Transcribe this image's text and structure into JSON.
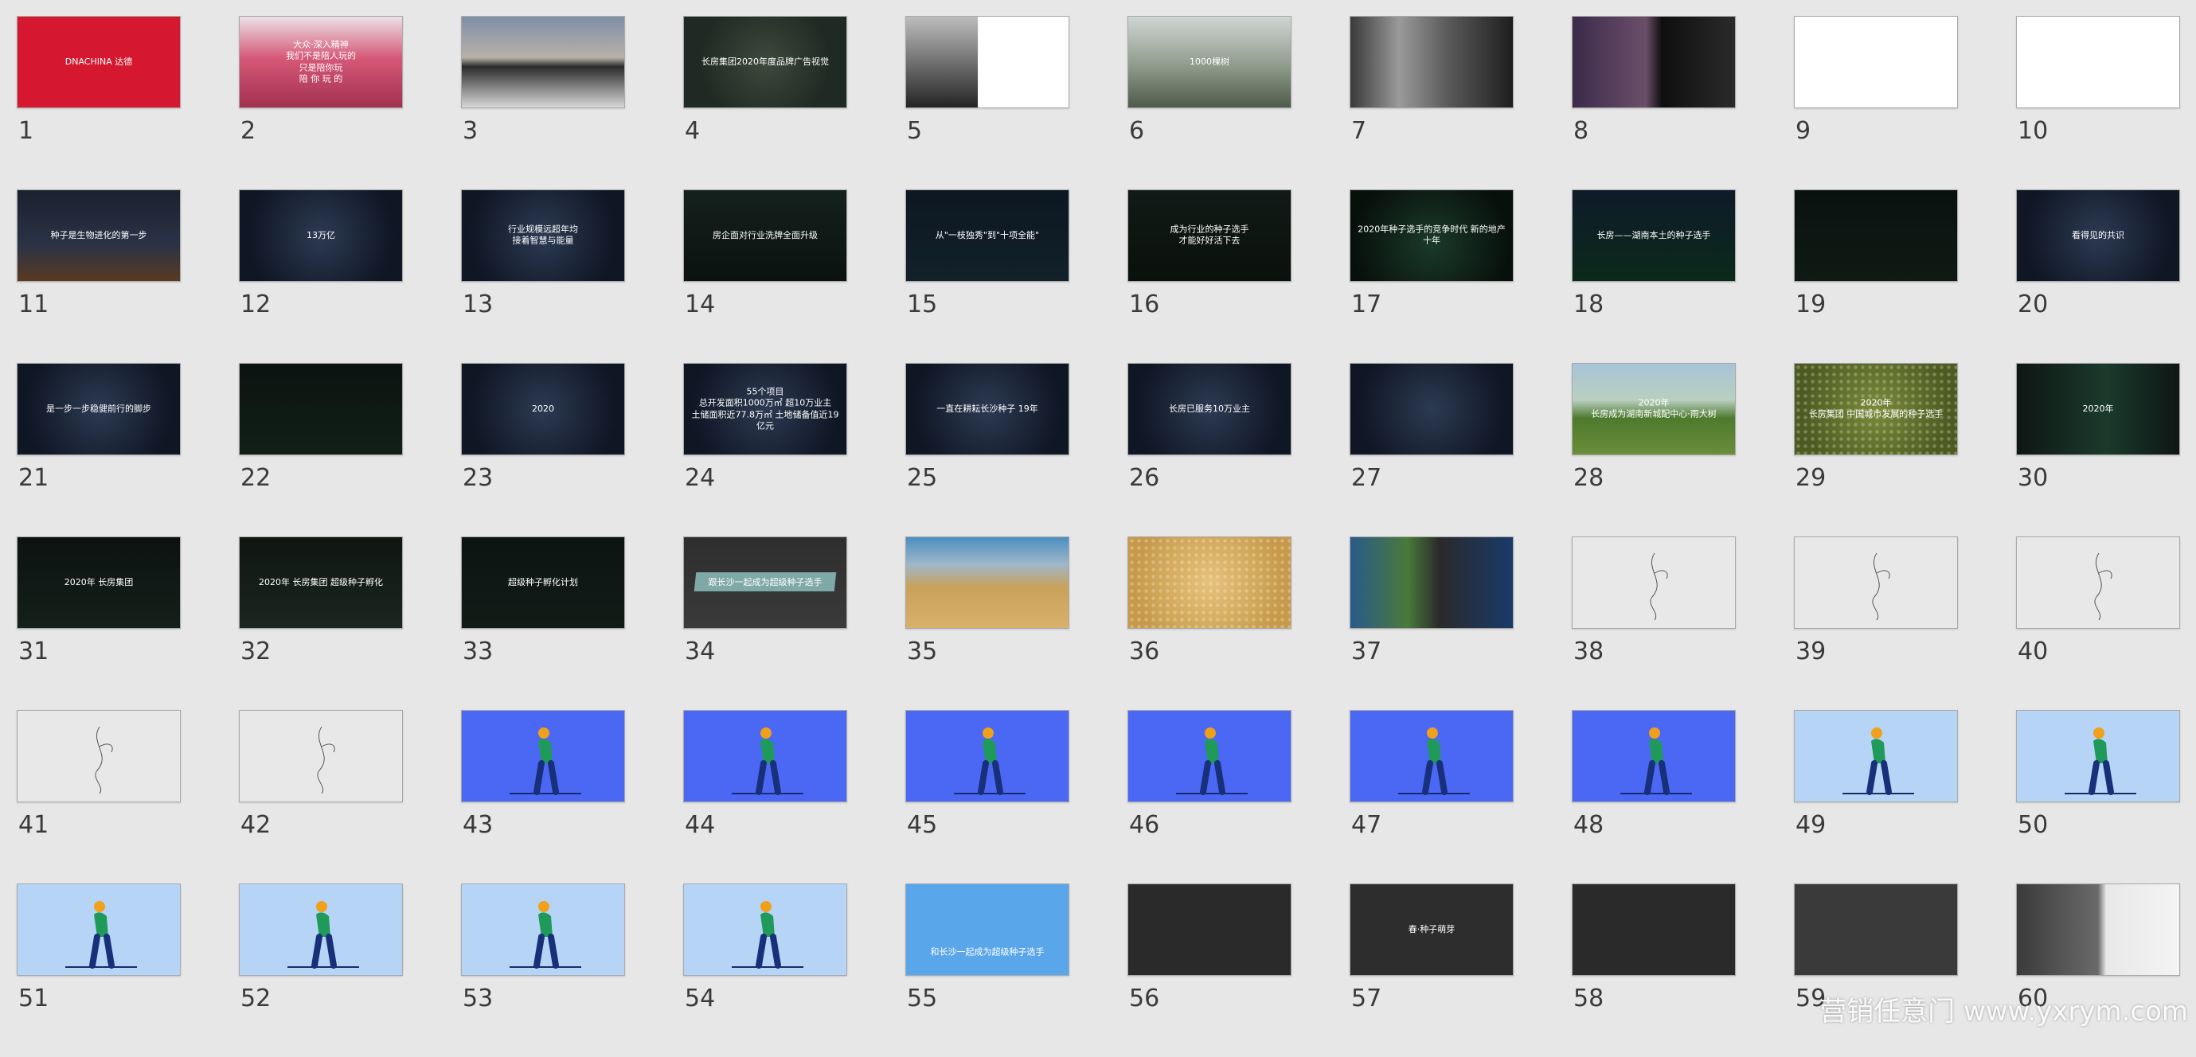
{
  "slides": [
    {
      "num": "1",
      "bg": "#d5182f",
      "text": "DNACHINA 达德",
      "dark": false
    },
    {
      "num": "2",
      "bg": "linear-gradient(180deg,#ece0e6 0%,#d65a78 45%,#a3304f 100%)",
      "text": "大众·深入精神\n我们不是陪人玩的\n只是陪你玩\n陪 你 玩 的",
      "dark": false
    },
    {
      "num": "3",
      "bg": "linear-gradient(180deg,#7f8fa8 0%,#b7b0a8 45%,#2b2b2b 55%,#d8d8d8 100%)",
      "text": "",
      "dark": false
    },
    {
      "num": "4",
      "bg": "radial-gradient(circle at 50% 50%,#3d4a3c 0%,#1f2a24 70%)",
      "text": "长房集团2020年度品牌广告视觉",
      "dark": false
    },
    {
      "num": "5",
      "bg": "linear-gradient(90deg,#2a2a2a 0%,#8a8a8a 35%,#ffffff 45%,#ffffff 100%)",
      "text": "",
      "dark": true
    },
    {
      "num": "6",
      "bg": "linear-gradient(180deg,#cfd6d4 0%,#8e9a8a 55%,#4e5a4a 100%)",
      "text": "1000棵树",
      "dark": false
    },
    {
      "num": "7",
      "bg": "linear-gradient(90deg,#3a3a3a 0%,#9a9a9a 30%,#5a5a5a 60%,#1e1e1e 100%)",
      "text": "",
      "dark": false
    },
    {
      "num": "8",
      "bg": "linear-gradient(90deg,#3b2a4a 0%,#6b4f6a 45%,#0f0f0f 55%,#2a2a2a 100%)",
      "text": "",
      "dark": false
    },
    {
      "num": "9",
      "bg": "#ffffff",
      "text": "",
      "dark": true
    },
    {
      "num": "10",
      "bg": "#ffffff",
      "text": "",
      "dark": true
    },
    {
      "num": "11",
      "bg": "linear-gradient(180deg,#1a2230 0%,#2a3246 60%,#5a3a22 100%)",
      "text": "种子是生物进化的第一步",
      "dark": false
    },
    {
      "num": "12",
      "bg": "radial-gradient(circle at 50% 50%,#2c3a52 0%,#0f1624 80%)",
      "text": "13万亿",
      "dark": false
    },
    {
      "num": "13",
      "bg": "radial-gradient(circle at 50% 50%,#2c3a52 0%,#0f1624 80%)",
      "text": "行业规模远超年均\n接着智慧与能量",
      "dark": false
    },
    {
      "num": "14",
      "bg": "linear-gradient(180deg,#14211c 0%,#0b120f 100%)",
      "text": "房企面对行业洗牌全面升级",
      "dark": false
    },
    {
      "num": "15",
      "bg": "linear-gradient(180deg,#0c1722 0%,#12212a 100%)",
      "text": "从\"一枝独秀\"到\"十项全能\"",
      "dark": false
    },
    {
      "num": "16",
      "bg": "linear-gradient(180deg,#111a16 0%,#0a110d 100%)",
      "text": "成为行业的种子选手\n才能好好活下去",
      "dark": false
    },
    {
      "num": "17",
      "bg": "radial-gradient(circle at 50% 60%,#1a3a2a 0%,#08100c 80%)",
      "text": "2020年种子选手的竞争时代 新的地产十年",
      "dark": false
    },
    {
      "num": "18",
      "bg": "linear-gradient(180deg,#0f1a2a 0%,#0a2a1a 100%)",
      "text": "长房——湖南本土的种子选手",
      "dark": false
    },
    {
      "num": "19",
      "bg": "linear-gradient(180deg,#0a1210 0%,#0f1a14 100%)",
      "text": "",
      "dark": false
    },
    {
      "num": "20",
      "bg": "radial-gradient(circle at 50% 50%,#2c3a52 0%,#0f1624 80%)",
      "text": "看得见的共识",
      "dark": false
    },
    {
      "num": "21",
      "bg": "radial-gradient(circle at 50% 50%,#2c3a52 0%,#0f1624 80%)",
      "text": "是一步一步稳健前行的脚步",
      "dark": false
    },
    {
      "num": "22",
      "bg": "linear-gradient(180deg,#0c1310 0%,#102018 100%)",
      "text": "",
      "dark": false
    },
    {
      "num": "23",
      "bg": "radial-gradient(circle at 50% 50%,#2c3a52 0%,#0f1624 80%)",
      "text": "2020",
      "dark": false
    },
    {
      "num": "24",
      "bg": "radial-gradient(circle at 50% 50%,#2c3a52 0%,#0f1624 80%)",
      "text": "55个项目\n总开发面积1000万㎡ 超10万业主\n土储面积近77.8万㎡ 土地储备值近19亿元",
      "dark": false
    },
    {
      "num": "25",
      "bg": "radial-gradient(circle at 50% 50%,#2c3a52 0%,#0f1624 80%)",
      "text": "一直在耕耘长沙种子 19年",
      "dark": false
    },
    {
      "num": "26",
      "bg": "radial-gradient(circle at 50% 50%,#2c3a52 0%,#0f1624 80%)",
      "text": "长房已服务10万业主",
      "dark": false
    },
    {
      "num": "27",
      "bg": "radial-gradient(circle at 50% 50%,#2c3a52 0%,#0f1624 80%)",
      "text": "",
      "dark": false
    },
    {
      "num": "28",
      "bg": "linear-gradient(180deg,#a8c4d8 0%,#b9cfbf 40%,#4e7a2e 60%,#6a8e3a 100%)",
      "text": "2020年\n长房成为湖南新城配中心·雨大树",
      "dark": false
    },
    {
      "num": "29",
      "bg": "radial-gradient(circle at 50% 50%,#7a8a3a 0%,#4d5a20 80%)",
      "text": "2020年\n长房集团 中国城市发展的种子选手",
      "dark": false
    },
    {
      "num": "30",
      "bg": "linear-gradient(90deg,#0f1614 0%,#1a3a2c 55%,#0f1614 100%)",
      "text": "2020年",
      "dark": false
    },
    {
      "num": "31",
      "bg": "linear-gradient(180deg,#0c1210 0%,#14201a 100%)",
      "text": "2020年 长房集团",
      "dark": false
    },
    {
      "num": "32",
      "bg": "linear-gradient(180deg,#0f1612 0%,#1a2620 100%)",
      "text": "2020年 长房集团   超级种子孵化",
      "dark": false
    },
    {
      "num": "33",
      "bg": "linear-gradient(180deg,#0c1411 0%,#111c17 100%)",
      "text": "超级种子孵化计划",
      "dark": false
    },
    {
      "num": "34",
      "bg": "linear-gradient(180deg,#2e2e2e 0%,#3a3a3a 100%)",
      "text": "跟长沙一起成为超级种子选手",
      "dark": false
    },
    {
      "num": "35",
      "bg": "linear-gradient(180deg,#4b8fc0 0%,#9fb7c8 30%,#caa15a 55%,#d9b06a 100%)",
      "text": "",
      "dark": false
    },
    {
      "num": "36",
      "bg": "radial-gradient(circle at 50% 50%,#e6c27a 0%,#c79a4a 80%)",
      "text": "",
      "dark": false
    },
    {
      "num": "37",
      "bg": "linear-gradient(90deg,#2a5a8a 0%,#4a7a3a 35%,#2a2a2a 55%,#1a3a6a 100%)",
      "text": "",
      "dark": false
    },
    {
      "num": "38",
      "bg": "#e8e8e8",
      "text": "",
      "dark": true
    },
    {
      "num": "39",
      "bg": "#e8e8e8",
      "text": "",
      "dark": true
    },
    {
      "num": "40",
      "bg": "#e8e8e8",
      "text": "",
      "dark": true
    },
    {
      "num": "41",
      "bg": "#e8e8e8",
      "text": "",
      "dark": true
    },
    {
      "num": "42",
      "bg": "#e8e8e8",
      "text": "",
      "dark": true
    },
    {
      "num": "43",
      "bg": "#4b68f5",
      "text": "",
      "dark": false
    },
    {
      "num": "44",
      "bg": "#4b68f5",
      "text": "",
      "dark": false
    },
    {
      "num": "45",
      "bg": "#4b68f5",
      "text": "",
      "dark": false
    },
    {
      "num": "46",
      "bg": "#4b68f5",
      "text": "",
      "dark": false
    },
    {
      "num": "47",
      "bg": "#4b68f5",
      "text": "",
      "dark": false
    },
    {
      "num": "48",
      "bg": "#4b68f5",
      "text": "",
      "dark": false
    },
    {
      "num": "49",
      "bg": "#b6d5f6",
      "text": "",
      "dark": true
    },
    {
      "num": "50",
      "bg": "#b6d5f6",
      "text": "",
      "dark": true
    },
    {
      "num": "51",
      "bg": "#b6d5f6",
      "text": "",
      "dark": true
    },
    {
      "num": "52",
      "bg": "#b6d5f6",
      "text": "",
      "dark": true
    },
    {
      "num": "53",
      "bg": "#b6d5f6",
      "text": "",
      "dark": true
    },
    {
      "num": "54",
      "bg": "#b6d5f6",
      "text": "",
      "dark": true
    },
    {
      "num": "55",
      "bg": "#5aa6ea",
      "text": "\n\n\n\n和长沙一起成为超级种子选手",
      "dark": false
    },
    {
      "num": "56",
      "bg": "#2a2a2a",
      "text": "",
      "dark": false
    },
    {
      "num": "57",
      "bg": "#2d2d2d",
      "text": "春·种子萌芽",
      "dark": false
    },
    {
      "num": "58",
      "bg": "#2a2a2a",
      "text": "",
      "dark": false
    },
    {
      "num": "59",
      "bg": "#3a3a3a",
      "text": "",
      "dark": false
    },
    {
      "num": "60",
      "bg": "linear-gradient(90deg,#3a3a3a 0%,#6a6a6a 50%,#e8e8e8 55%,#f4f4f4 100%)",
      "text": "",
      "dark": false
    }
  ],
  "watermark": "营销任意门 www.yxrym.com"
}
